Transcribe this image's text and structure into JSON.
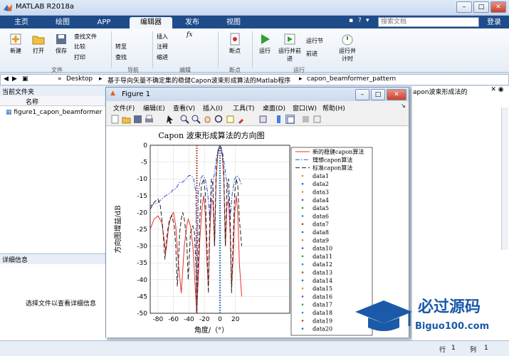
{
  "window": {
    "title": "MATLAB R2018a"
  },
  "tabs": [
    "主页",
    "绘图",
    "APP",
    "编辑器",
    "发布",
    "视图"
  ],
  "search": {
    "placeholder": "搜索文档"
  },
  "login": "登录",
  "ribbon": {
    "new": "新建",
    "open": "打开",
    "save": "保存",
    "find_files": "查找文件",
    "compare": "比较",
    "print": "打印",
    "goto": "转至",
    "find": "查找",
    "insert": "插入",
    "comment": "注释",
    "indent": "缩进",
    "fx": "fx",
    "breakpoints": "断点",
    "run": "运行",
    "run_advance": "运行并前进",
    "run_section": "运行节",
    "advance": "前进",
    "run_time": "运行并计时",
    "groups": {
      "file": "文件",
      "navigate": "导航",
      "edit": "编辑",
      "breakpoints": "断点",
      "run": "运行"
    }
  },
  "address": {
    "parts": [
      "Desktop",
      "基于导向矢量不确定集的稳健Capon波束形成算法的Matlab程序",
      "capon_beamformer_pattern"
    ],
    "sep1": "»",
    "sep2": "▸"
  },
  "current_folder": {
    "title": "当前文件夹",
    "column": "名称",
    "file": "figure1_capon_beamformer"
  },
  "details": {
    "title": "详细信息",
    "hint": "选择文件以查看详细信息"
  },
  "right_pane": {
    "snippet": "apon波束形成法的"
  },
  "status": {
    "row_label": "行",
    "row": "1",
    "col_label": "列",
    "col": "1"
  },
  "figure": {
    "title": "Figure 1",
    "menu": [
      "文件(F)",
      "编辑(E)",
      "查看(V)",
      "插入(I)",
      "工具(T)",
      "桌面(D)",
      "窗口(W)",
      "帮助(H)"
    ]
  },
  "logo": {
    "name": "必过源码",
    "url": "Biguo100.com"
  },
  "chart_data": {
    "type": "line",
    "title": "Capon 波束形成算法的方向图",
    "xlabel": "角度/（°）",
    "ylabel": "方向图增益/dB",
    "xlim": [
      -90,
      90
    ],
    "ylim": [
      -50,
      0
    ],
    "xticks": [
      -80,
      -60,
      -40,
      -20,
      0,
      20
    ],
    "yticks": [
      0,
      -5,
      -10,
      -15,
      -20,
      -25,
      -30,
      -35,
      -40,
      -45,
      -50
    ],
    "grid": true,
    "legend_position": "right",
    "series": [
      {
        "name": "新的稳健capon算法",
        "color": "#e8302a",
        "style": "solid",
        "x": [
          -90,
          -85,
          -80,
          -75,
          -72,
          -70,
          -66,
          -63,
          -60,
          -57,
          -54,
          -50,
          -46,
          -43,
          -41,
          -38,
          -35,
          -33,
          -31,
          -30,
          -28,
          -26,
          -23,
          -21,
          -19,
          -17,
          -15,
          -13,
          -11,
          -9,
          -7,
          -5,
          -3,
          -1,
          0,
          1,
          3,
          5,
          7,
          9,
          11,
          13,
          15,
          17,
          19,
          21,
          23,
          25,
          28
        ],
        "y": [
          -25,
          -22,
          -21,
          -23,
          -28,
          -32,
          -24,
          -21,
          -20,
          -24,
          -34,
          -44,
          -30,
          -24,
          -22,
          -24,
          -30,
          -38,
          -46,
          -50,
          -40,
          -28,
          -18,
          -15,
          -20,
          -34,
          -42,
          -26,
          -16,
          -17,
          -30,
          -10,
          -3,
          -0.5,
          0,
          -0.5,
          -3,
          -10,
          -30,
          -18,
          -16,
          -26,
          -42,
          -34,
          -20,
          -15,
          -20,
          -35,
          -45
        ]
      },
      {
        "name": "理想capon算法",
        "color": "#3050c8",
        "style": "dashdot",
        "x": [
          -90,
          -80,
          -70,
          -63,
          -60,
          -57,
          -52,
          -48,
          -44,
          -40,
          -37,
          -34,
          -31,
          -30,
          -28,
          -25,
          -22,
          -19,
          -16,
          -13,
          -10,
          -7,
          -4,
          -2,
          0,
          2,
          4,
          7,
          10,
          13,
          16,
          19,
          22,
          25,
          28
        ],
        "y": [
          -18,
          -17,
          -15,
          -14,
          -13,
          -13,
          -11,
          -11,
          -10,
          -9,
          -9,
          -10,
          -14,
          -50,
          -14,
          -10,
          -9,
          -10,
          -14,
          -22,
          -13,
          -8,
          -3,
          -1,
          0,
          -1,
          -3,
          -8,
          -13,
          -22,
          -14,
          -10,
          -9,
          -10,
          -12
        ]
      },
      {
        "name": "标准capon算法",
        "color": "#222222",
        "style": "dashed",
        "x": [
          -90,
          -85,
          -80,
          -77,
          -74,
          -71,
          -68,
          -65,
          -62,
          -59,
          -57,
          -55,
          -52,
          -50,
          -48,
          -46,
          -43,
          -41,
          -38,
          -35,
          -33,
          -31,
          -30,
          -28,
          -26,
          -24,
          -21,
          -19,
          -17,
          -15,
          -13,
          -11,
          -9,
          -7,
          -5,
          -3,
          -1,
          0,
          1,
          3,
          5,
          7,
          9,
          11,
          13,
          15,
          17,
          19,
          21,
          23,
          25,
          28
        ],
        "y": [
          -19,
          -17,
          -16,
          -18,
          -24,
          -34,
          -26,
          -22,
          -21,
          -24,
          -30,
          -42,
          -26,
          -22,
          -20,
          -22,
          -28,
          -40,
          -26,
          -24,
          -26,
          -36,
          -50,
          -35,
          -22,
          -12,
          -10,
          -14,
          -28,
          -44,
          -20,
          -10,
          -12,
          -30,
          -8,
          -3,
          -0.5,
          0,
          -0.5,
          -3,
          -8,
          -30,
          -12,
          -10,
          -20,
          -44,
          -28,
          -14,
          -10,
          -12,
          -22,
          -30
        ]
      },
      {
        "name": "data1",
        "color": "#ff8c00",
        "style": "dotted",
        "x": [
          -30,
          -30
        ],
        "y": [
          0,
          -50
        ]
      },
      {
        "name": "data2",
        "color": "#3060d0",
        "style": "dotted",
        "x": [
          -29.5,
          -29.5
        ],
        "y": [
          0,
          -50
        ]
      },
      {
        "name": "data3",
        "color": "#e09020",
        "style": "dotted",
        "x": [
          -30.5,
          -30.5
        ],
        "y": [
          0,
          -50
        ]
      },
      {
        "name": "data4",
        "color": "#8040a0",
        "style": "dotted",
        "x": [
          0,
          0
        ],
        "y": [
          0,
          -50
        ]
      },
      {
        "name": "data5",
        "color": "#30a040",
        "style": "dotted",
        "x": [
          0.5,
          0.5
        ],
        "y": [
          0,
          -50
        ]
      },
      {
        "name": "data6",
        "color": "#2090c0",
        "style": "dotted",
        "x": [
          -0.5,
          -0.5
        ],
        "y": [
          0,
          -50
        ]
      },
      {
        "name": "data7",
        "color": "#c03030",
        "style": "dotted",
        "x": [
          -30,
          -30
        ],
        "y": [
          0,
          -50
        ]
      },
      {
        "name": "data8",
        "color": "#3060d0",
        "style": "dotted",
        "x": [
          0,
          0
        ],
        "y": [
          0,
          -50
        ]
      },
      {
        "name": "data9",
        "color": "#e09020",
        "style": "dotted",
        "x": [
          -30,
          -30
        ],
        "y": [
          0,
          -50
        ]
      },
      {
        "name": "data10",
        "color": "#8040a0",
        "style": "dotted",
        "x": [
          0,
          0
        ],
        "y": [
          0,
          -50
        ]
      },
      {
        "name": "data11",
        "color": "#30a040",
        "style": "dotted",
        "x": [
          -30,
          -30
        ],
        "y": [
          0,
          -50
        ]
      },
      {
        "name": "data12",
        "color": "#2090c0",
        "style": "dotted",
        "x": [
          0,
          0
        ],
        "y": [
          0,
          -50
        ]
      },
      {
        "name": "data13",
        "color": "#c03030",
        "style": "dotted",
        "x": [
          -30,
          -30
        ],
        "y": [
          0,
          -50
        ]
      },
      {
        "name": "data14",
        "color": "#3060d0",
        "style": "dotted",
        "x": [
          0,
          0
        ],
        "y": [
          0,
          -50
        ]
      },
      {
        "name": "data15",
        "color": "#e09020",
        "style": "dotted",
        "x": [
          -30,
          -30
        ],
        "y": [
          0,
          -50
        ]
      },
      {
        "name": "data16",
        "color": "#8040a0",
        "style": "dotted",
        "x": [
          0,
          0
        ],
        "y": [
          0,
          -50
        ]
      },
      {
        "name": "data17",
        "color": "#30a040",
        "style": "dotted",
        "x": [
          -30,
          -30
        ],
        "y": [
          0,
          -50
        ]
      },
      {
        "name": "data18",
        "color": "#2090c0",
        "style": "dotted",
        "x": [
          0,
          0
        ],
        "y": [
          0,
          -50
        ]
      },
      {
        "name": "data19",
        "color": "#c03030",
        "style": "dotted",
        "x": [
          -30,
          -30
        ],
        "y": [
          0,
          -50
        ]
      },
      {
        "name": "data20",
        "color": "#3060d0",
        "style": "dotted",
        "x": [
          0,
          0
        ],
        "y": [
          0,
          -50
        ]
      }
    ]
  }
}
